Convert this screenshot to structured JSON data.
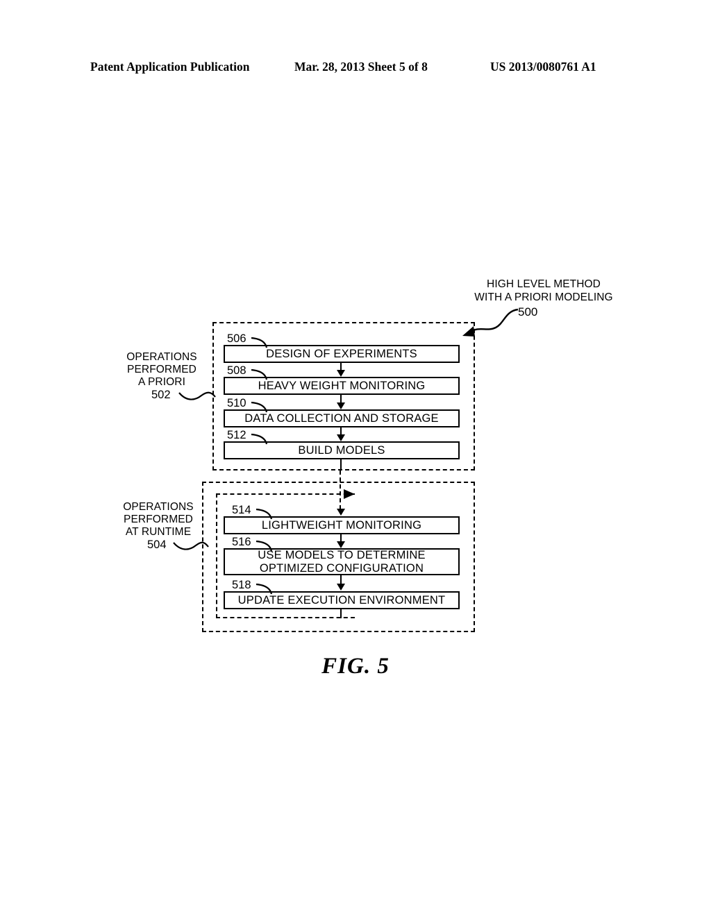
{
  "header": {
    "left": "Patent Application Publication",
    "middle": "Mar. 28, 2013  Sheet 5 of 8",
    "right": "US 2013/0080761 A1"
  },
  "figure": {
    "caption": "FIG. 5",
    "title": "HIGH LEVEL METHOD\nWITH A PRIORI MODELING",
    "title_ref": "500",
    "groups": [
      {
        "id": "apriori",
        "label": "OPERATIONS\nPERFORMED\nA PRIORI",
        "ref": "502"
      },
      {
        "id": "runtime",
        "label": "OPERATIONS\nPERFORMED\nAT RUNTIME",
        "ref": "504"
      }
    ],
    "boxes": [
      {
        "ref": "506",
        "text": "DESIGN OF EXPERIMENTS"
      },
      {
        "ref": "508",
        "text": "HEAVY WEIGHT MONITORING"
      },
      {
        "ref": "510",
        "text": "DATA COLLECTION AND STORAGE"
      },
      {
        "ref": "512",
        "text": "BUILD MODELS"
      },
      {
        "ref": "514",
        "text": "LIGHTWEIGHT MONITORING"
      },
      {
        "ref": "516",
        "text": "USE MODELS TO DETERMINE\nOPTIMIZED CONFIGURATION"
      },
      {
        "ref": "518",
        "text": "UPDATE EXECUTION ENVIRONMENT"
      }
    ]
  }
}
